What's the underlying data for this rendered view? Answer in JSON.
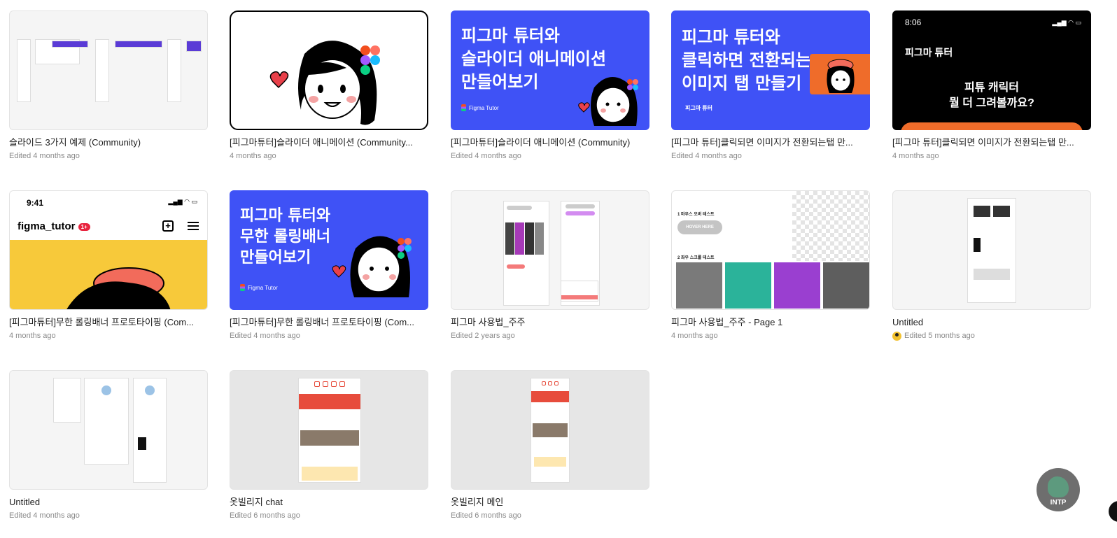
{
  "files": [
    {
      "title": "슬라이드 3가지 예제 (Community)",
      "meta": "Edited 4 months ago"
    },
    {
      "title": "[피그마튜터]슬라이더 애니메이션 (Community...",
      "meta": "4 months ago"
    },
    {
      "title": "[피그마튜터]슬라이더 애니메이션 (Community)",
      "meta": "Edited 4 months ago"
    },
    {
      "title": "[피그마 튜터]클릭되면 이미지가 전환되는탭 만...",
      "meta": "Edited 4 months ago"
    },
    {
      "title": "[피그마 튜터]클릭되면 이미지가 전환되는탭 만...",
      "meta": "4 months ago"
    },
    {
      "title": "[피그마튜터]무한 롤링배너 프로토타이핑 (Com...",
      "meta": "4 months ago"
    },
    {
      "title": "[피그마튜터]무한 롤링배너 프로토타이핑 (Com...",
      "meta": "Edited 4 months ago"
    },
    {
      "title": "피그마 사용법_주주",
      "meta": "Edited 2 years ago"
    },
    {
      "title": "피그마 사용법_주주 - Page 1",
      "meta": "4 months ago"
    },
    {
      "title": "Untitled",
      "meta": "Edited 5 months ago"
    },
    {
      "title": "Untitled",
      "meta": "Edited 4 months ago"
    },
    {
      "title": "옷빌리지 chat",
      "meta": "Edited 6 months ago"
    },
    {
      "title": "옷빌리지 메인",
      "meta": "Edited 6 months ago"
    }
  ],
  "thumbs": {
    "t3_line1": "피그마 튜터와",
    "t3_line2": "슬라이더 애니메이션",
    "t3_line3": "만들어보기",
    "t3_brand": "Figma Tutor",
    "t4_line1": "피그마 튜터와",
    "t4_line2": "클릭하면 전환되는",
    "t4_line3": "이미지 탭 만들기",
    "t4_brand": "피그마 튜터",
    "t5_time": "8:06",
    "t5_brand": "피그마 튜터",
    "t5_line1": "피튜 캐릭터",
    "t5_line2": "뭘 더 그려볼까요?",
    "t6_time": "9:41",
    "t6_handle": "figma_tutor",
    "t6_badge": "1+",
    "t7_line1": "피그마 튜터와",
    "t7_line2": "무한 롤링배너",
    "t7_line3": "만들어보기",
    "t7_brand": "Figma Tutor",
    "t9_label1": "1 마우스 오버 테스트",
    "t9_button": "HOVER HERE",
    "t9_label2": "2 좌우 스크롤 테스트"
  },
  "assistant": {
    "label": "INTP"
  },
  "colors": {
    "blue": "#3f52f6",
    "orange": "#ef6c2a",
    "yellow": "#f7c93a",
    "red": "#e74c3c"
  }
}
